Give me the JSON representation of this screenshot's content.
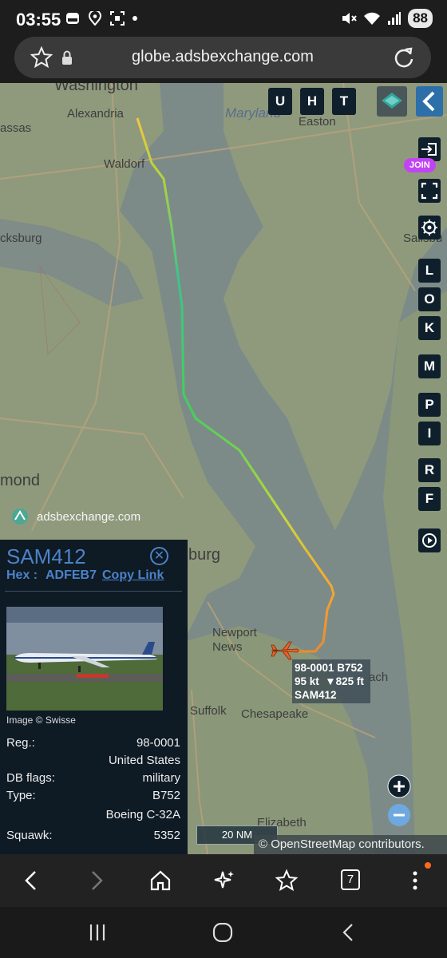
{
  "status_bar": {
    "time": "03:55",
    "battery": "88"
  },
  "browser": {
    "url": "globe.adsbexchange.com",
    "tabs_count": "7"
  },
  "map": {
    "labels": {
      "washington": "Washington",
      "alexandria": "Alexandria",
      "assas": "assas",
      "waldorf": "Waldorf",
      "maryland": "Maryland",
      "easton": "Easton",
      "salisbu": "Salisbu",
      "cksburg": "cksburg",
      "mond": "mond",
      "burg": "burg",
      "newport_news": "Newport\nNews",
      "suffolk": "Suffolk",
      "chesapeake": "Chesapeake",
      "elizabeth": "Elizabeth",
      "ach": "ach"
    },
    "top_buttons": [
      "U",
      "H",
      "T"
    ],
    "side_buttons": [
      "L",
      "O",
      "K",
      "M",
      "P",
      "I",
      "R",
      "F"
    ],
    "join_label": "JOIN",
    "watermark": "adsbexchange.com",
    "scale": "20 NM",
    "attribution": "© OpenStreetMap contributors.",
    "aircraft_label": {
      "line1": "98-0001 B752",
      "line2": "95 kt  ▼825 ft",
      "line3": "SAM412"
    }
  },
  "panel": {
    "callsign": "SAM412",
    "hex_label": "Hex :",
    "hex_value": "ADFEB7",
    "copy_link": "Copy Link",
    "photo_credit": "Image © Swisse",
    "rows": {
      "reg_label": "Reg.:",
      "reg_value": "98-0001",
      "country": "United States",
      "dbflags_label": "DB flags:",
      "dbflags_value": "military",
      "type_label": "Type:",
      "type_value": "B752",
      "model": "Boeing C-32A",
      "squawk_label": "Squawk:",
      "squawk_value": "5352"
    }
  },
  "colors": {
    "accent": "#4c82c8",
    "join": "#c144f2",
    "panel_bg": "#0e1a24",
    "aircraft": "#e8622a"
  }
}
